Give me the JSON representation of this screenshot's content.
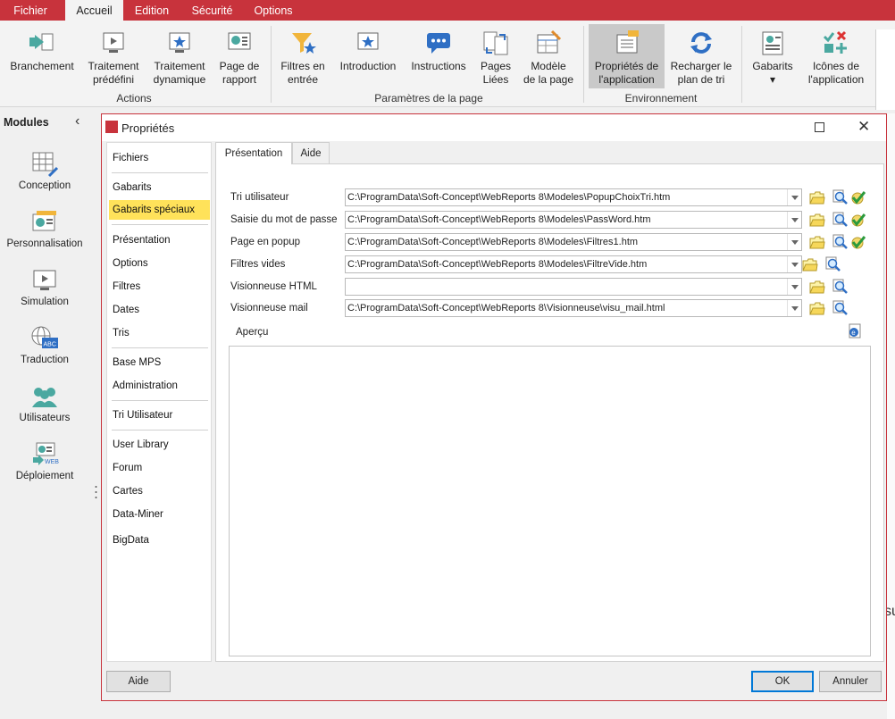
{
  "menu": [
    "Fichier",
    "Accueil",
    "Edition",
    "Sécurité",
    "Options"
  ],
  "ribbon": {
    "buttons": [
      {
        "label": "Branchement",
        "icon": "branch-arrow-icon"
      },
      {
        "label": "Traitement\nprédéfini",
        "icon": "predefined-screen-icon"
      },
      {
        "label": "Traitement\ndynamique",
        "icon": "dynamic-star-icon"
      },
      {
        "label": "Page de\nrapport",
        "icon": "report-page-icon"
      },
      {
        "label": "Filtres en\nentrée",
        "icon": "funnel-star-icon"
      },
      {
        "label": "Introduction",
        "icon": "intro-star-icon"
      },
      {
        "label": "Instructions",
        "icon": "chat-bubble-icon"
      },
      {
        "label": "Pages\nLiées",
        "icon": "linked-pages-icon"
      },
      {
        "label": "Modèle\nde la page",
        "icon": "page-template-icon"
      },
      {
        "label": "Propriétés de\nl'application",
        "icon": "app-properties-icon"
      },
      {
        "label": "Recharger le\nplan de tri",
        "icon": "reload-icon"
      },
      {
        "label": "Gabarits\n▾",
        "icon": "templates-icon"
      },
      {
        "label": "Icônes de\nl'application",
        "icon": "app-icons-icon"
      }
    ],
    "groups": [
      "Actions",
      "Paramètres de la page",
      "Environnement"
    ]
  },
  "modules": {
    "title": "Modules",
    "items": [
      {
        "label": "Conception",
        "icon": "design-grid-icon"
      },
      {
        "label": "Personnalisation",
        "icon": "personalization-icon"
      },
      {
        "label": "Simulation",
        "icon": "simulation-screen-icon"
      },
      {
        "label": "Traduction",
        "icon": "translation-globe-icon"
      },
      {
        "label": "Utilisateurs",
        "icon": "users-icon"
      },
      {
        "label": "Déploiement",
        "icon": "web-deploy-icon"
      }
    ]
  },
  "dialog": {
    "title": "Propriétés",
    "list": [
      "Fichiers",
      "Gabarits",
      "Gabarits spéciaux",
      "Présentation",
      "Options",
      "Filtres",
      "Dates",
      "Tris",
      "Base MPS",
      "Administration",
      "Tri Utilisateur",
      "User Library",
      "Forum",
      "Cartes",
      "Data-Miner",
      "BigData"
    ],
    "selected": "Gabarits spéciaux",
    "tabs": [
      "Présentation",
      "Aide"
    ],
    "fields": [
      {
        "label": "Tri utilisateur",
        "value": "C:\\ProgramData\\Soft-Concept\\WebReports 8\\Modeles\\PopupChoixTri.htm"
      },
      {
        "label": "Saisie du mot de passe",
        "value": "C:\\ProgramData\\Soft-Concept\\WebReports 8\\Modeles\\PassWord.htm"
      },
      {
        "label": "Page en popup",
        "value": "C:\\ProgramData\\Soft-Concept\\WebReports 8\\Modeles\\Filtres1.htm"
      },
      {
        "label": "Filtres vides",
        "value": "C:\\ProgramData\\Soft-Concept\\WebReports 8\\Modeles\\FiltreVide.htm"
      },
      {
        "label": "Visionneuse HTML",
        "value": ""
      },
      {
        "label": "Visionneuse mail",
        "value": "C:\\ProgramData\\Soft-Concept\\WebReports 8\\Visionneuse\\visu_mail.html"
      }
    ],
    "preview_label": "Aperçu",
    "buttons": {
      "help": "Aide",
      "ok": "OK",
      "cancel": "Annuler"
    }
  },
  "background_text": "su"
}
